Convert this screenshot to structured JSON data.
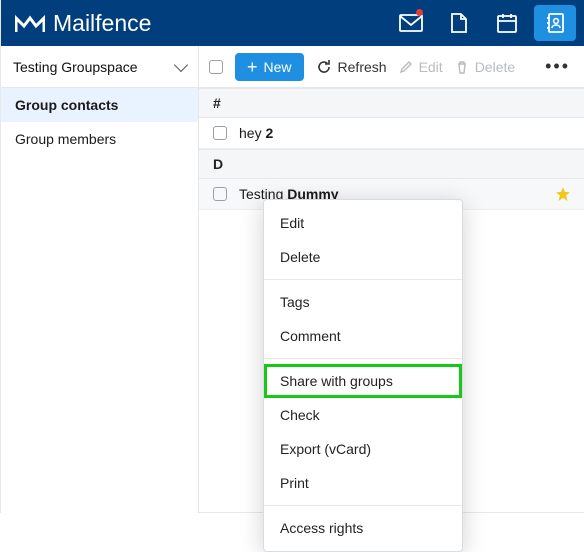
{
  "brand": "Mailfence",
  "top_icons": {
    "mail": "mail-icon",
    "docs": "document-icon",
    "calendar": "calendar-icon",
    "contacts": "contacts-icon"
  },
  "sidebar": {
    "group_selector": "Testing Groupspace",
    "items": [
      {
        "label": "Group contacts",
        "selected": true
      },
      {
        "label": "Group members",
        "selected": false
      }
    ]
  },
  "toolbar": {
    "new_label": "New",
    "refresh_label": "Refresh",
    "edit_label": "Edit",
    "delete_label": "Delete"
  },
  "list": {
    "sections": [
      {
        "header": "#",
        "rows": [
          {
            "name_prefix": "hey ",
            "name_bold": "2",
            "hovered": false
          }
        ]
      },
      {
        "header": "D",
        "rows": [
          {
            "name_prefix": "Testing ",
            "name_bold": "Dummy",
            "hovered": true
          }
        ]
      }
    ]
  },
  "context_menu": {
    "items": [
      {
        "label": "Edit"
      },
      {
        "label": "Delete"
      },
      {
        "sep": true
      },
      {
        "label": "Tags"
      },
      {
        "label": "Comment"
      },
      {
        "sep": true
      },
      {
        "label": "Share with groups",
        "highlighted": true
      },
      {
        "label": "Check"
      },
      {
        "label": "Export (vCard)"
      },
      {
        "label": "Print"
      },
      {
        "sep": true
      },
      {
        "label": "Access rights"
      }
    ]
  }
}
